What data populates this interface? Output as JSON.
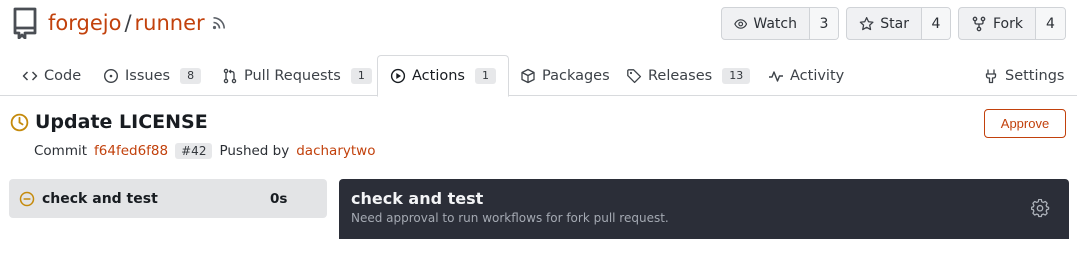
{
  "repo": {
    "owner": "forgejo",
    "separator": "/",
    "name": "runner"
  },
  "actions": {
    "watch": {
      "label": "Watch",
      "count": "3"
    },
    "star": {
      "label": "Star",
      "count": "4"
    },
    "fork": {
      "label": "Fork",
      "count": "4"
    }
  },
  "tabs": [
    {
      "label": "Code",
      "icon": "code-icon",
      "badge": ""
    },
    {
      "label": "Issues",
      "icon": "issue-icon",
      "badge": "8"
    },
    {
      "label": "Pull Requests",
      "icon": "pull-request-icon",
      "badge": "1"
    },
    {
      "label": "Actions",
      "icon": "play-icon",
      "badge": "1",
      "active": true
    },
    {
      "label": "Packages",
      "icon": "package-icon",
      "badge": ""
    },
    {
      "label": "Releases",
      "icon": "tag-icon",
      "badge": "13"
    },
    {
      "label": "Activity",
      "icon": "pulse-icon",
      "badge": ""
    },
    {
      "label": "Settings",
      "icon": "tools-icon",
      "badge": ""
    }
  ],
  "run": {
    "title": "Update LICENSE",
    "status_icon": "clock-icon",
    "approve_label": "Approve",
    "commit_label": "Commit",
    "commit_sha": "f64fed6f88",
    "pr_number": "#42",
    "pushed_by_label": "Pushed by",
    "pusher": "dacharytwo"
  },
  "jobs": [
    {
      "name": "check and test",
      "duration": "0s",
      "status_icon": "blocked-icon"
    }
  ],
  "job_panel": {
    "title": "check and test",
    "message": "Need approval to run workflows for fork pull request.",
    "settings_icon": "gear-icon"
  },
  "colors": {
    "accent": "#c2410c",
    "waiting": "#c58a0b",
    "panel_bg": "#2b2e38"
  }
}
